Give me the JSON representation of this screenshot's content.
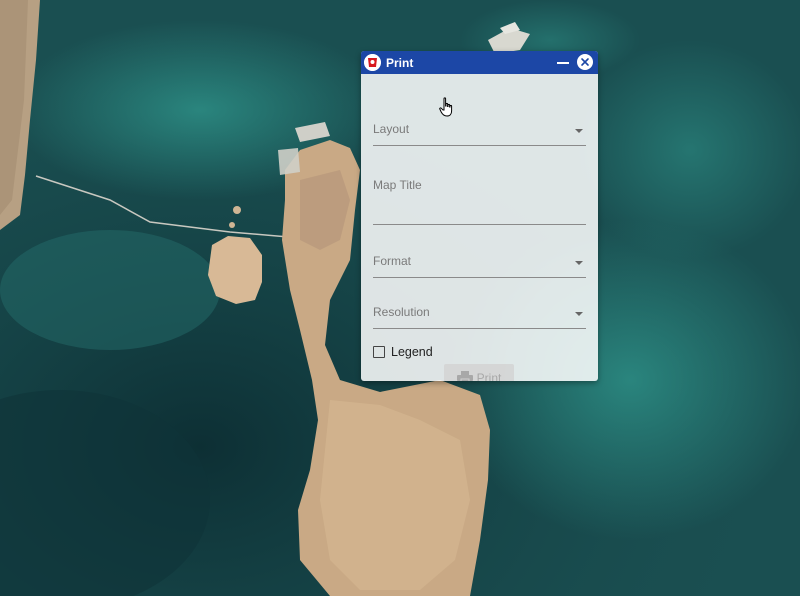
{
  "window": {
    "title": "Print",
    "minimize_icon": "minimize-icon",
    "close_icon": "close-icon",
    "logo_icon": "app-logo-icon",
    "header_color": "#1c47a6"
  },
  "form": {
    "layout_label": "Layout",
    "map_title_label": "Map Title",
    "format_label": "Format",
    "resolution_label": "Resolution",
    "legend_label": "Legend",
    "legend_checked": false,
    "print_label": "Print",
    "print_icon": "printer-icon"
  },
  "map": {
    "type": "satellite-imagery",
    "water_color": "#17474a",
    "land_color": "#c9a985"
  },
  "cursor": {
    "icon": "hand-pointer-icon"
  }
}
